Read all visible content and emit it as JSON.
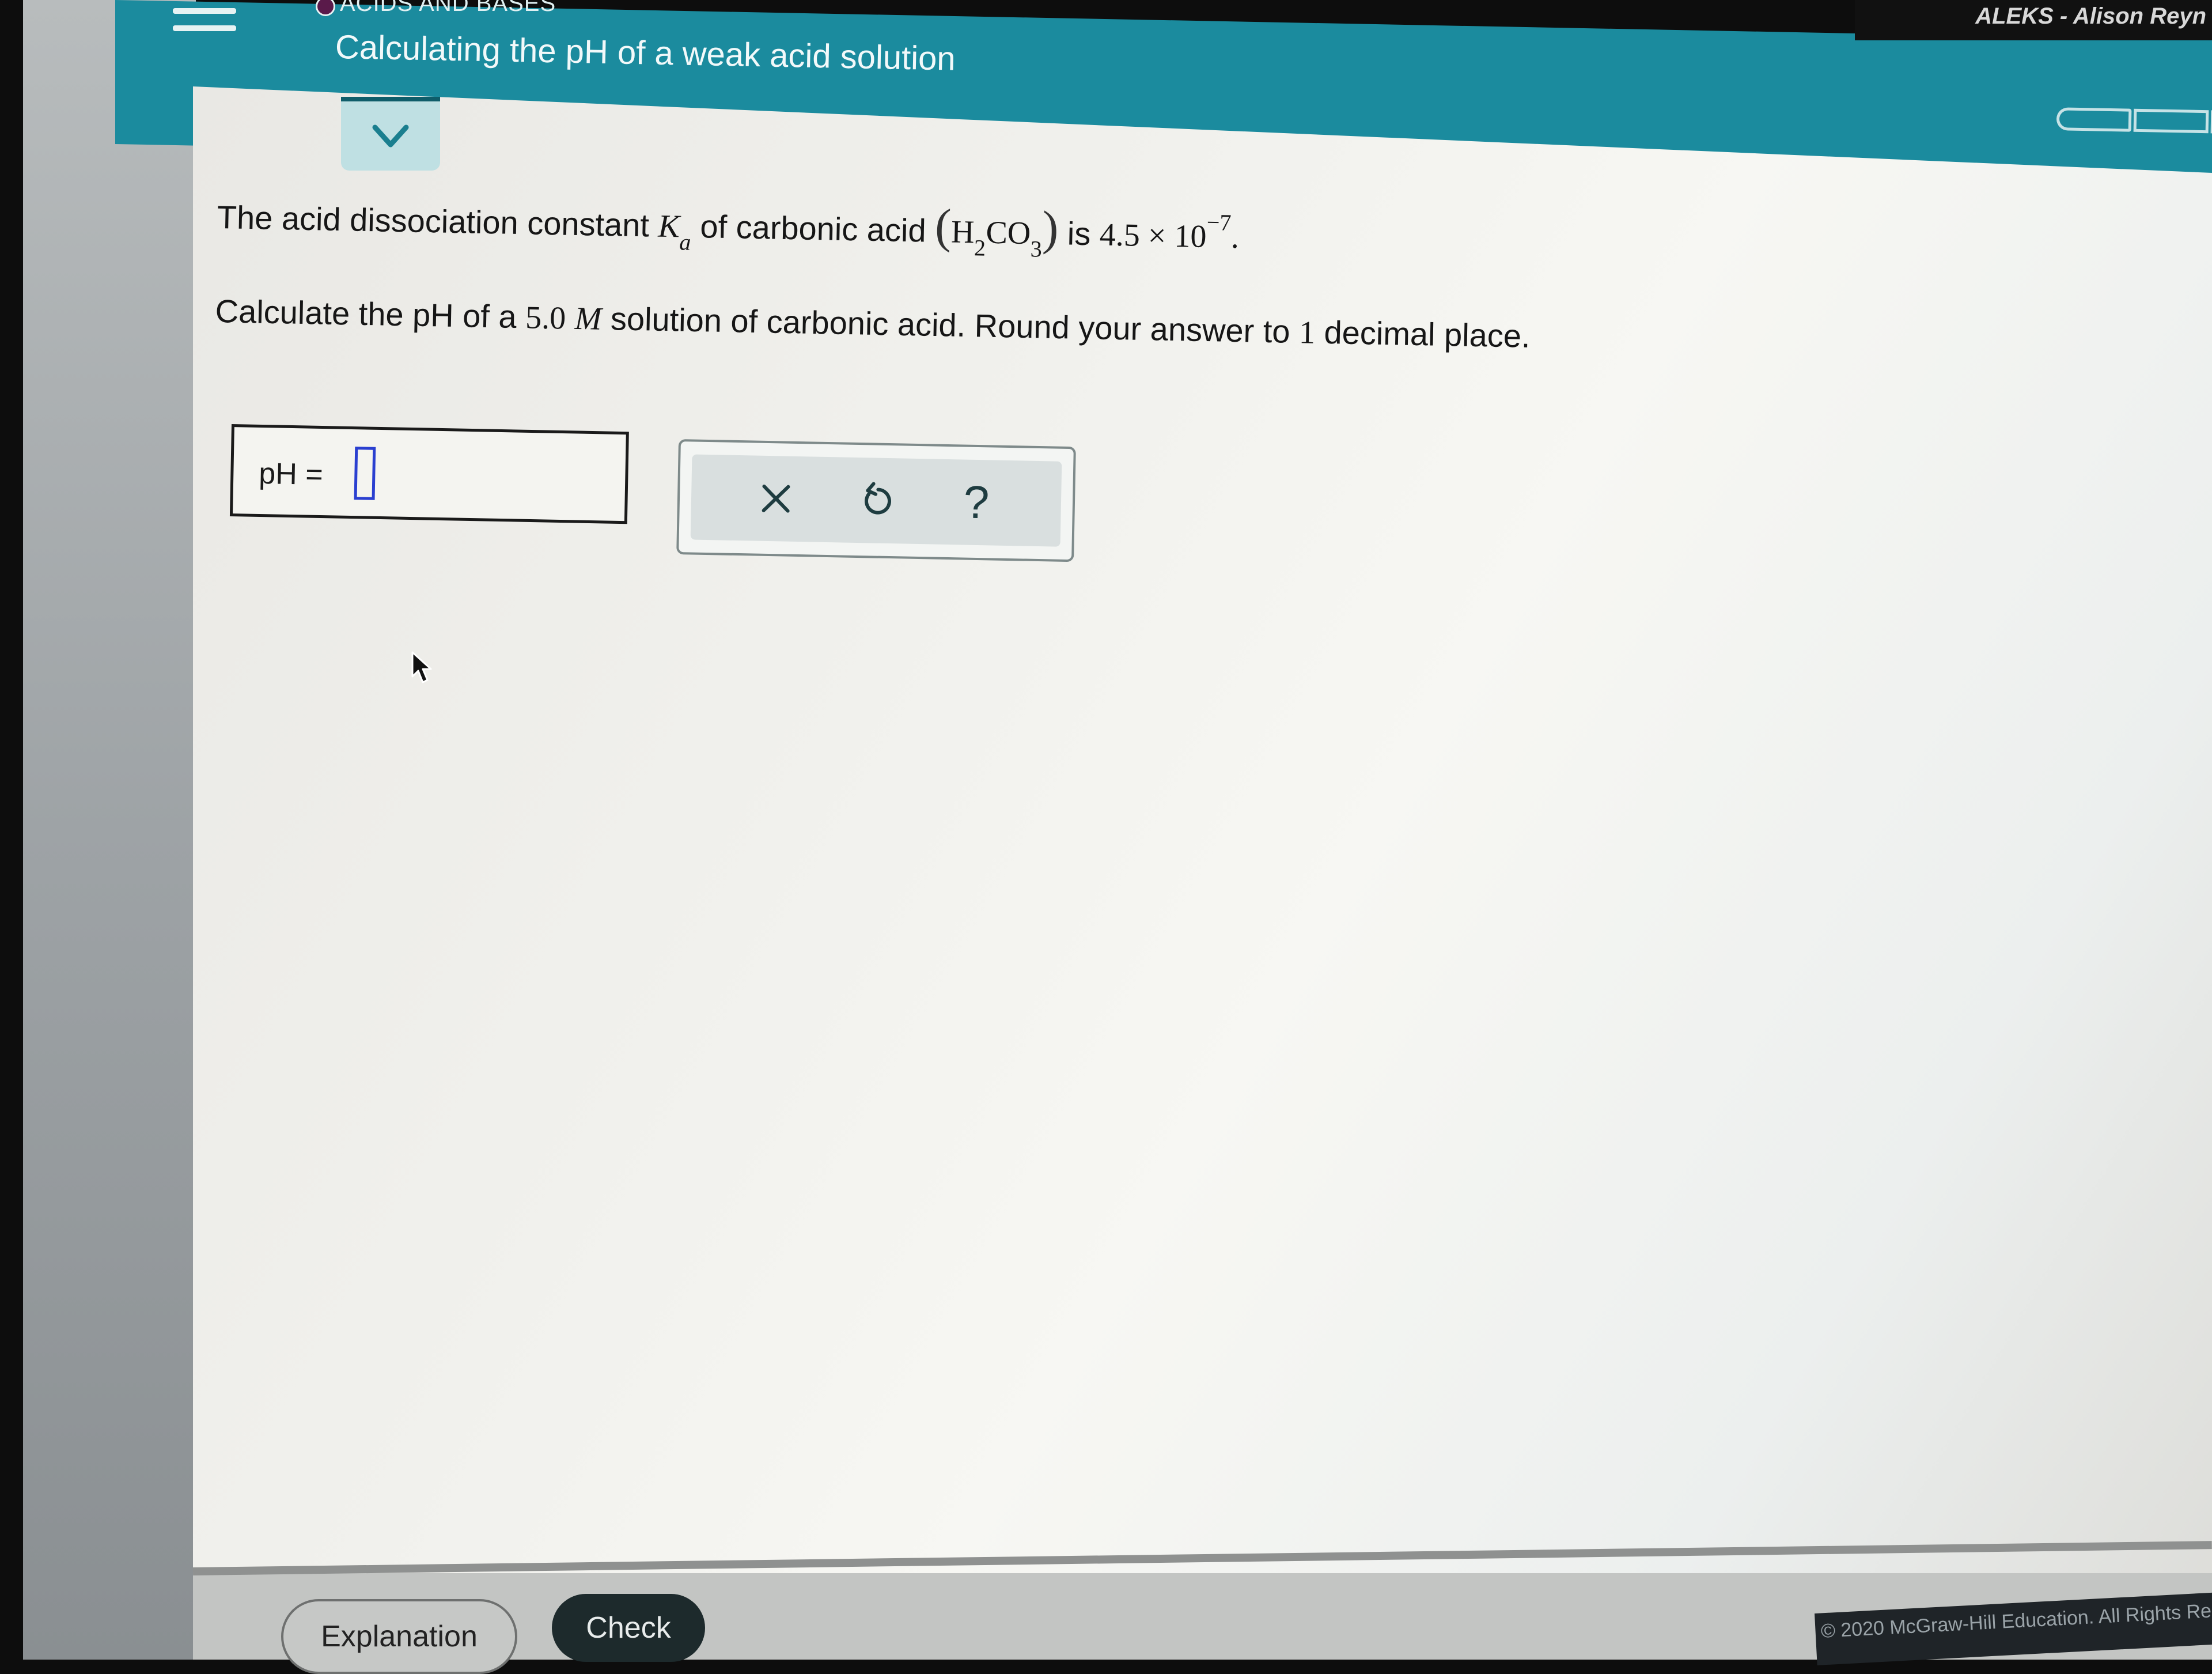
{
  "window": {
    "os_title": "ALEKS - Alison Reyn"
  },
  "header": {
    "section_label": "ACIDS AND BASES",
    "topic_title": "Calculating the pH of a weak acid solution",
    "menu_icon": "hamburger-menu-icon",
    "progress_segments": 3,
    "colors": {
      "header_bg": "#1b8b9e",
      "tab_bg": "#bfe0e3",
      "accent_dark": "#0f5d6a"
    }
  },
  "toggle": {
    "icon": "chevron-down-icon"
  },
  "question": {
    "line1": {
      "prefix": "The acid dissociation constant ",
      "k_symbol": "K",
      "k_sub": "a",
      "mid": " of carbonic acid ",
      "formula_h": "H",
      "formula_h_sub": "2",
      "formula_co": "CO",
      "formula_co_sub": "3",
      "paren_open": "(",
      "paren_close": ")",
      "is_text": " is ",
      "value": "4.5 × 10",
      "exponent": "−7",
      "end": "."
    },
    "line2": {
      "prefix": "Calculate the pH of a ",
      "concentration": "5.0",
      "unit": "M",
      "suffix": " solution of carbonic acid. Round your answer to ",
      "decimals": "1",
      "end": " decimal place."
    }
  },
  "answer": {
    "label": "pH =",
    "value": "",
    "placeholder": ""
  },
  "tools": {
    "clear_label": "×",
    "clear_icon": "close-icon",
    "undo_icon": "undo-icon",
    "help_label": "?",
    "help_icon": "help-icon"
  },
  "footer": {
    "explanation_label": "Explanation",
    "check_label": "Check",
    "copyright": "© 2020 McGraw-Hill Education. All Rights Re"
  }
}
